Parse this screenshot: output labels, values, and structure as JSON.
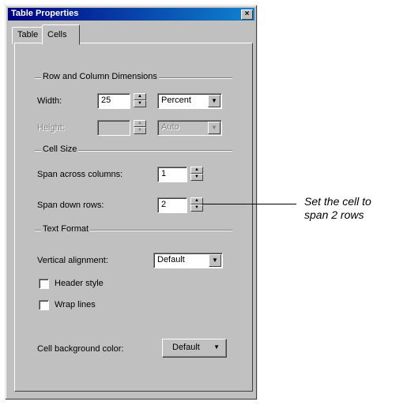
{
  "window": {
    "title": "Table Properties",
    "close_glyph": "×"
  },
  "tabs": [
    {
      "label": "Table"
    },
    {
      "label": "Cells",
      "active": true
    }
  ],
  "row_col": {
    "group_label": "Row and Column Dimensions",
    "width_label": "Width:",
    "width_value": "25",
    "width_unit": "Percent",
    "height_label": "Height:",
    "height_value": "",
    "height_unit": "Auto"
  },
  "cell_size": {
    "group_label": "Cell Size",
    "span_cols_label": "Span across columns:",
    "span_cols_value": "1",
    "span_rows_label": "Span down rows:",
    "span_rows_value": "2"
  },
  "text_format": {
    "group_label": "Text Format",
    "valign_label": "Vertical alignment:",
    "valign_value": "Default",
    "header_style_label": "Header style",
    "wrap_lines_label": "Wrap lines"
  },
  "bg": {
    "label": "Cell background color:",
    "value": "Default"
  },
  "callout": {
    "line1": "Set the cell to",
    "line2": "span 2 rows"
  },
  "icons": {
    "up": "▲",
    "down": "▼"
  }
}
